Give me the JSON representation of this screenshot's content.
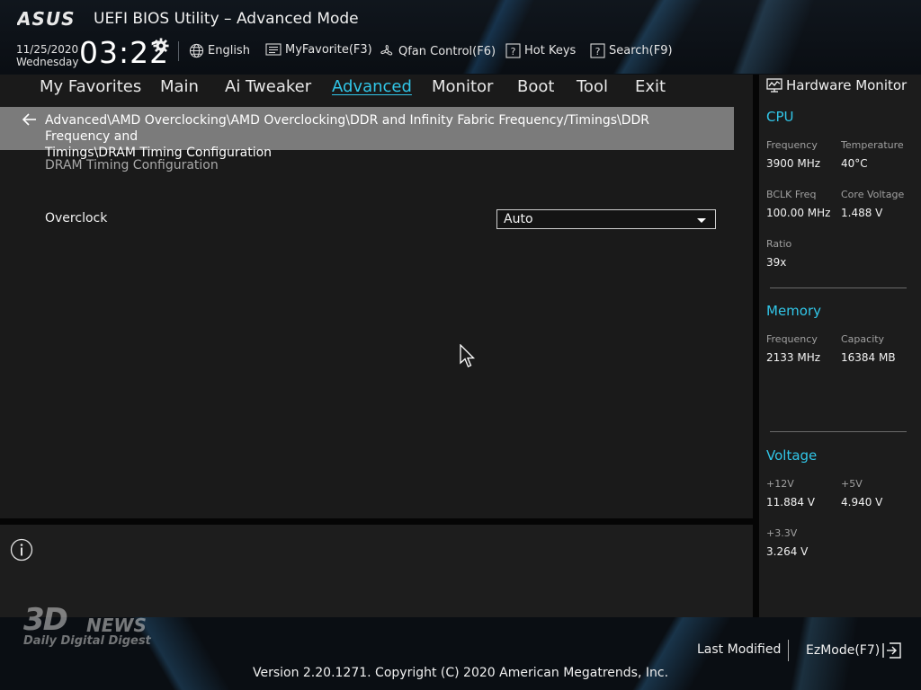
{
  "header": {
    "logo_text": "ASUS",
    "title": "UEFI BIOS Utility – Advanced Mode",
    "date": "11/25/2020",
    "weekday": "Wednesday",
    "time": "03:22",
    "language": "English",
    "myfavorite": "MyFavorite(F3)",
    "qfan": "Qfan Control(F6)",
    "hotkeys": "Hot Keys",
    "search": "Search(F9)"
  },
  "nav": {
    "items": [
      "My Favorites",
      "Main",
      "Ai Tweaker",
      "Advanced",
      "Monitor",
      "Boot",
      "Tool",
      "Exit"
    ],
    "active": "Advanced"
  },
  "breadcrumb": {
    "line1": "Advanced\\AMD Overclocking\\AMD Overclocking\\DDR and Infinity Fabric Frequency/Timings\\DDR Frequency and",
    "line2": "Timings\\DRAM Timing Configuration"
  },
  "page": {
    "section_label": "DRAM Timing Configuration",
    "overclock_label": "Overclock",
    "overclock_value": "Auto"
  },
  "hardware_monitor": {
    "title": "Hardware Monitor",
    "cpu": {
      "heading": "CPU",
      "frequency_label": "Frequency",
      "frequency_value": "3900 MHz",
      "temperature_label": "Temperature",
      "temperature_value": "40°C",
      "bclk_label": "BCLK Freq",
      "bclk_value": "100.00 MHz",
      "core_voltage_label": "Core Voltage",
      "core_voltage_value": "1.488 V",
      "ratio_label": "Ratio",
      "ratio_value": "39x"
    },
    "memory": {
      "heading": "Memory",
      "frequency_label": "Frequency",
      "frequency_value": "2133 MHz",
      "capacity_label": "Capacity",
      "capacity_value": "16384 MB"
    },
    "voltage": {
      "heading": "Voltage",
      "v12_label": "+12V",
      "v12_value": "11.884 V",
      "v5_label": "+5V",
      "v5_value": "4.940 V",
      "v33_label": "+3.3V",
      "v33_value": "3.264 V"
    }
  },
  "footer": {
    "last_modified": "Last Modified",
    "ezmode": "EzMode(F7)",
    "version": "Version 2.20.1271. Copyright (C) 2020 American Megatrends, Inc."
  },
  "watermark": {
    "main": "3D",
    "news": "NEWS",
    "tagline": "Daily Digital Digest"
  },
  "colors": {
    "accent": "#31c6e8",
    "breadcrumb_bg": "#7b7b7b",
    "panel_bg": "#1a1a1a"
  },
  "icons": [
    "gear-icon",
    "globe-icon",
    "favorite-icon",
    "fan-icon",
    "hotkeys-icon",
    "search-icon",
    "back-arrow-icon",
    "dropdown-caret-icon",
    "info-icon",
    "monitor-icon",
    "ezmode-exit-icon",
    "mouse-cursor-icon"
  ]
}
